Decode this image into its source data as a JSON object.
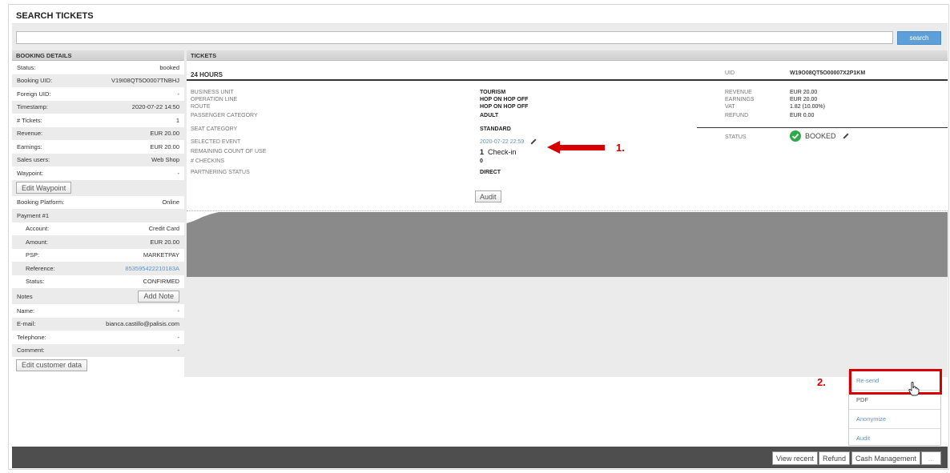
{
  "page": {
    "title": "SEARCH TICKETS"
  },
  "search": {
    "value": "",
    "button": "search"
  },
  "booking_details": {
    "header": "BOOKING DETAILS",
    "rows": [
      {
        "key": "Status:",
        "value": "booked"
      },
      {
        "key": "Booking UID:",
        "value": "V19I08QT5O0007TNBHJ"
      },
      {
        "key": "Foreign UID:",
        "value": "-"
      },
      {
        "key": "Timestamp:",
        "value": "2020-07-22 14:50"
      },
      {
        "key": "# Tickets:",
        "value": "1"
      },
      {
        "key": "Revenue:",
        "value": "EUR 20.00"
      },
      {
        "key": "Earnings:",
        "value": "EUR 20.00"
      },
      {
        "key": "Sales users:",
        "value": "Web Shop"
      },
      {
        "key": "Waypoint:",
        "value": "-"
      }
    ],
    "edit_waypoint": "Edit Waypoint",
    "booking_platform": {
      "key": "Booking Platform:",
      "value": "Online"
    },
    "payment_label": "Payment #1",
    "payment_rows": [
      {
        "key": "Account:",
        "value": "Credit Card"
      },
      {
        "key": "Amount:",
        "value": "EUR 20.00"
      },
      {
        "key": "PSP:",
        "value": "MARKETPAY"
      },
      {
        "key": "Reference:",
        "value": "853595422210183A"
      },
      {
        "key": "Status:",
        "value": "CONFIRMED"
      }
    ],
    "notes_label": "Notes",
    "add_note": "Add Note",
    "customer_rows": [
      {
        "key": "Name:",
        "value": "-"
      },
      {
        "key": "E-mail:",
        "value": "bianca.castillo@palisis.com"
      },
      {
        "key": "Telephone:",
        "value": "-"
      },
      {
        "key": "Comment:",
        "value": "-"
      }
    ],
    "edit_customer": "Edit customer data"
  },
  "tickets": {
    "header": "TICKETS",
    "ticket_name": "24 HOURS",
    "uid_label": "UID",
    "uid_value": "W19O08QT5O00007X2P1KM",
    "left_fields": [
      {
        "key": "BUSINESS UNIT",
        "value": "TOURISM"
      },
      {
        "key": "OPERATION LINE",
        "value": "HOP ON HOP OFF"
      },
      {
        "key": "ROUTE",
        "value": "HOP ON HOP OFF"
      },
      {
        "key": "PASSENGER CATEGORY",
        "value": "ADULT"
      },
      {
        "key": "SEAT CATEGORY",
        "value": "STANDARD"
      },
      {
        "key": "SELECTED EVENT",
        "value": "2020-07-22 22:59"
      },
      {
        "key": "REMAINING COUNT OF USE",
        "value_count": "1",
        "value_unit": "Check-in"
      },
      {
        "key": "# CHECKINS",
        "value": "0"
      },
      {
        "key": "PARTNERING STATUS",
        "value": "DIRECT"
      }
    ],
    "right_fields": [
      {
        "key": "REVENUE",
        "value": "EUR 20.00"
      },
      {
        "key": "EARNINGS",
        "value": "EUR 20.00"
      },
      {
        "key": "VAT",
        "value": "1.82 (10.00%)"
      },
      {
        "key": "REFUND",
        "value": "EUR 0.00"
      }
    ],
    "status_label": "STATUS",
    "status_value": "BOOKED",
    "audit": "Audit"
  },
  "annotations": {
    "step1": "1.",
    "step2": "2."
  },
  "dropdown": {
    "items": [
      "Re-send",
      "PDF",
      "Anonymize",
      "Audit"
    ]
  },
  "bottom_bar": {
    "view_recent": "View recent",
    "refund": "Refund",
    "cash_management": "Cash Management",
    "more": "..."
  },
  "colors": {
    "accent": "#5d9fd6",
    "annotation": "#d60000",
    "status_ok": "#2eaa4a",
    "bottom_bar": "#4e4e4e"
  }
}
